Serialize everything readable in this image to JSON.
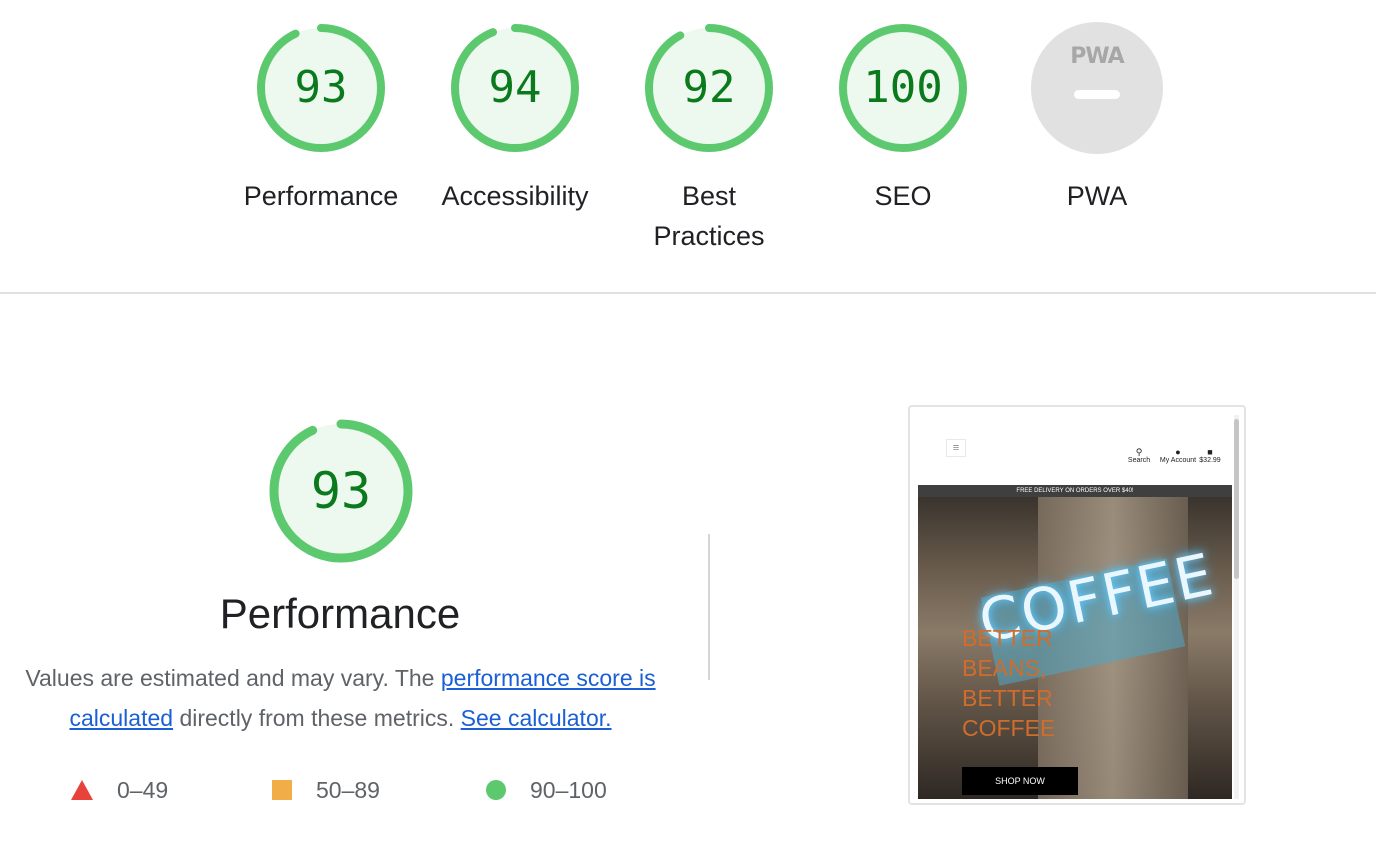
{
  "colors": {
    "pass": "#0a7a1d",
    "pass_ring": "#5dc96f",
    "pass_fill": "#edf8ef",
    "average": "#f1ad47",
    "fail": "#e8433b",
    "link": "#1a5fd6",
    "pwa_gray": "#e1e1e1"
  },
  "gauges": [
    {
      "score": "93",
      "value": 0.93,
      "label": "Performance"
    },
    {
      "score": "94",
      "value": 0.94,
      "label": "Accessibility"
    },
    {
      "score": "92",
      "value": 0.92,
      "label_line1": "Best",
      "label_line2": "Practices"
    },
    {
      "score": "100",
      "value": 1.0,
      "label": "SEO"
    }
  ],
  "pwa": {
    "badge_text": "PWA",
    "label": "PWA"
  },
  "performance": {
    "score": "93",
    "value": 0.93,
    "title": "Performance",
    "desc_part1": "Values are estimated and may vary. The ",
    "link_score": "performance score is calculated",
    "desc_part2": " directly from these metrics. ",
    "link_calc": "See calculator.",
    "legend": {
      "fail": "0–49",
      "average": "50–89",
      "pass": "90–100"
    }
  },
  "screenshot": {
    "nav": {
      "search": "Search",
      "account": "My Account",
      "cart": "$32.99"
    },
    "promo": "FREE DELIVERY ON ORDERS OVER $40!",
    "sign_text": "COFFEE",
    "headline": [
      "BETTER",
      "BEANS,",
      "BETTER",
      "COFFEE"
    ],
    "button": "SHOP NOW"
  }
}
